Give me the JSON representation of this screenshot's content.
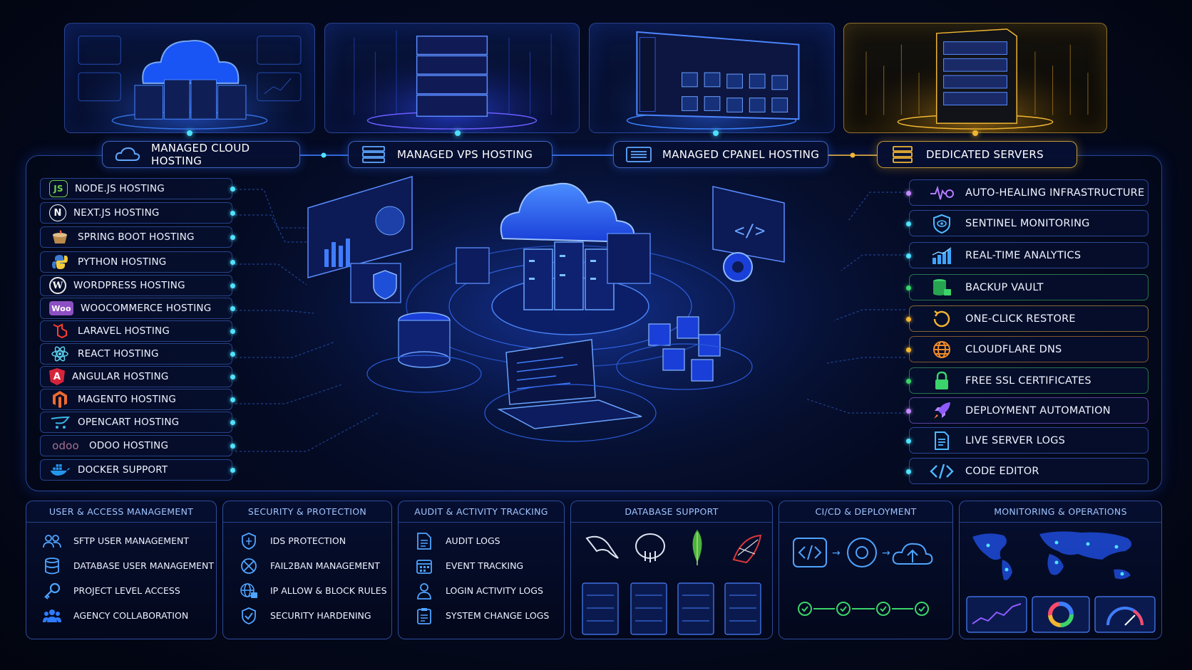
{
  "hero_tabs": [
    {
      "label": "MANAGED CLOUD HOSTING",
      "icon": "cloud-icon"
    },
    {
      "label": "MANAGED VPS HOSTING",
      "icon": "server-stack-icon"
    },
    {
      "label": "MANAGED CPANEL HOSTING",
      "icon": "control-panel-icon"
    },
    {
      "label": "DEDICATED SERVERS",
      "icon": "dedicated-server-icon"
    }
  ],
  "left_list": [
    {
      "label": "NODE.JS HOSTING",
      "icon": "nodejs-icon"
    },
    {
      "label": "NEXT.JS HOSTING",
      "icon": "nextjs-icon"
    },
    {
      "label": "SPRING BOOT HOSTING",
      "icon": "spring-boot-icon"
    },
    {
      "label": "PYTHON HOSTING",
      "icon": "python-icon"
    },
    {
      "label": "WORDPRESS HOSTING",
      "icon": "wordpress-icon"
    },
    {
      "label": "WOOCOMMERCE HOSTING",
      "icon": "woocommerce-icon"
    },
    {
      "label": "LARAVEL HOSTING",
      "icon": "laravel-icon"
    },
    {
      "label": "REACT HOSTING",
      "icon": "react-icon"
    },
    {
      "label": "ANGULAR HOSTING",
      "icon": "angular-icon"
    },
    {
      "label": "MAGENTO HOSTING",
      "icon": "magento-icon"
    },
    {
      "label": "OPENCART HOSTING",
      "icon": "opencart-icon"
    },
    {
      "label": "ODOO HOSTING",
      "icon": "odoo-icon"
    },
    {
      "label": "DOCKER SUPPORT",
      "icon": "docker-icon"
    }
  ],
  "left_logo_text": {
    "node": "JS",
    "next": "N",
    "wp": "W",
    "woo": "Woo",
    "angular": "A",
    "odoo": "odoo"
  },
  "right_list": [
    {
      "label": "AUTO-HEALING INFRASTRUCTURE",
      "icon": "heartbeat-gear-icon"
    },
    {
      "label": "SENTINEL MONITORING",
      "icon": "shield-eye-icon"
    },
    {
      "label": "REAL-TIME ANALYTICS",
      "icon": "bar-chart-icon"
    },
    {
      "label": "BACKUP VAULT",
      "icon": "database-lock-icon"
    },
    {
      "label": "ONE-CLICK RESTORE",
      "icon": "restore-icon"
    },
    {
      "label": "CLOUDFLARE DNS",
      "icon": "globe-icon"
    },
    {
      "label": "FREE SSL CERTIFICATES",
      "icon": "padlock-icon"
    },
    {
      "label": "DEPLOYMENT AUTOMATION",
      "icon": "rocket-icon"
    },
    {
      "label": "LIVE SERVER LOGS",
      "icon": "document-icon"
    },
    {
      "label": "CODE EDITOR",
      "icon": "code-icon"
    }
  ],
  "bottom_panels": {
    "user_access": {
      "title": "USER & ACCESS MANAGEMENT",
      "items": [
        {
          "label": "SFTP USER MANAGEMENT",
          "icon": "users-icon"
        },
        {
          "label": "DATABASE USER MANAGEMENT",
          "icon": "database-icon"
        },
        {
          "label": "PROJECT LEVEL ACCESS",
          "icon": "key-icon"
        },
        {
          "label": "AGENCY COLLABORATION",
          "icon": "team-icon"
        }
      ]
    },
    "security": {
      "title": "SECURITY & PROTECTION",
      "items": [
        {
          "label": "IDS PROTECTION",
          "icon": "shield-icon"
        },
        {
          "label": "FAIL2BAN MANAGEMENT",
          "icon": "ban-icon"
        },
        {
          "label": "IP ALLOW & BLOCK RULES",
          "icon": "globe-lock-icon"
        },
        {
          "label": "SECURITY HARDENING",
          "icon": "shield-check-icon"
        }
      ]
    },
    "audit": {
      "title": "AUDIT & ACTIVITY TRACKING",
      "items": [
        {
          "label": "AUDIT LOGS",
          "icon": "document-icon"
        },
        {
          "label": "EVENT TRACKING",
          "icon": "calendar-icon"
        },
        {
          "label": "LOGIN ACTIVITY LOGS",
          "icon": "user-icon"
        },
        {
          "label": "SYSTEM CHANGE LOGS",
          "icon": "clipboard-icon"
        }
      ]
    },
    "database": {
      "title": "DATABASE SUPPORT"
    },
    "cicd": {
      "title": "CI/CD & DEPLOYMENT"
    },
    "monitoring": {
      "title": "MONITORING & OPERATIONS"
    }
  },
  "colors": {
    "accent_blue": "#2f7bff",
    "cyan": "#4fe3ff",
    "gold": "#f2b632",
    "purple": "#a06bff",
    "green": "#3bd46b"
  }
}
